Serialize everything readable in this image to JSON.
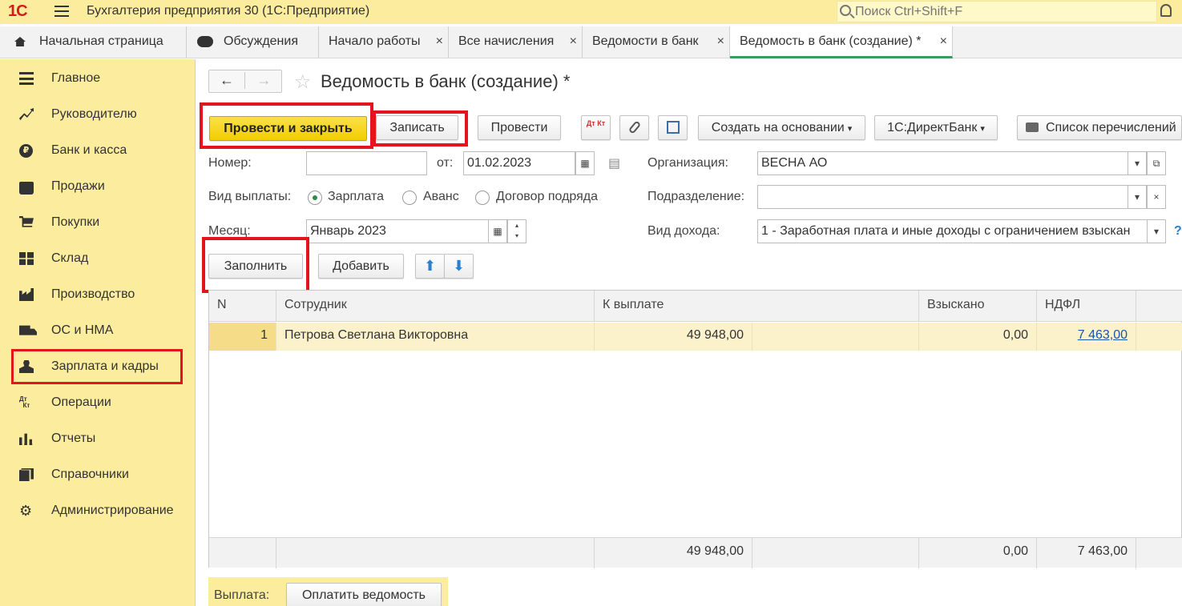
{
  "app": {
    "logo": "1С",
    "title": "Бухгалтерия предприятия 30  (1С:Предприятие)",
    "search_placeholder": "Поиск Ctrl+Shift+F"
  },
  "tabs": [
    {
      "label": "Начальная страница"
    },
    {
      "label": "Обсуждения"
    },
    {
      "label": "Начало работы"
    },
    {
      "label": "Все начисления"
    },
    {
      "label": "Ведомости в банк"
    },
    {
      "label": "Ведомость в банк (создание) *"
    }
  ],
  "close_glyph": "×",
  "sidebar": {
    "items": [
      {
        "label": "Главное",
        "icon": "menu-lines-icon"
      },
      {
        "label": "Руководителю",
        "icon": "trend-icon"
      },
      {
        "label": "Банк и касса",
        "icon": "ruble-coin-icon"
      },
      {
        "label": "Продажи",
        "icon": "bag-icon"
      },
      {
        "label": "Покупки",
        "icon": "cart-icon"
      },
      {
        "label": "Склад",
        "icon": "boxes-icon"
      },
      {
        "label": "Производство",
        "icon": "factory-icon"
      },
      {
        "label": "ОС и НМА",
        "icon": "truck-icon"
      },
      {
        "label": "Зарплата и кадры",
        "icon": "person-icon"
      },
      {
        "label": "Операции",
        "icon": "dt-kt-icon"
      },
      {
        "label": "Отчеты",
        "icon": "bar-chart-icon"
      },
      {
        "label": "Справочники",
        "icon": "books-icon"
      },
      {
        "label": "Администрирование",
        "icon": "gear-icon"
      }
    ]
  },
  "document": {
    "title": "Ведомость в банк (создание) *",
    "nav_back": "←",
    "nav_forward": "→",
    "star": "☆"
  },
  "toolbar": {
    "post_close": "Провести и закрыть",
    "save": "Записать",
    "post": "Провести",
    "dtkt": "Дт Кт",
    "create_based": "Создать на основании",
    "direct_bank": "1С:ДиректБанк",
    "print_list": "Список перечислений",
    "dropdown_glyph": "▾"
  },
  "form": {
    "number_label": "Номер:",
    "number_value": "",
    "date_label": "от:",
    "date_value": "01.02.2023",
    "org_label": "Организация:",
    "org_value": "ВЕСНА АО",
    "pay_type_label": "Вид выплаты:",
    "pay_types": [
      "Зарплата",
      "Аванс",
      "Договор подряда"
    ],
    "pay_type_selected": "Зарплата",
    "dept_label": "Подразделение:",
    "dept_value": "",
    "month_label": "Месяц:",
    "month_value": "Январь 2023",
    "income_label": "Вид дохода:",
    "income_value": "1 - Заработная плата и иные доходы с ограничением взыскан",
    "help": "?"
  },
  "table_toolbar": {
    "fill": "Заполнить",
    "add": "Добавить"
  },
  "table": {
    "columns": [
      "N",
      "Сотрудник",
      "К выплате",
      "Взыскано",
      "НДФЛ"
    ],
    "rows": [
      {
        "n": "1",
        "employee": "Петрова Светлана Викторовна",
        "to_pay": "49 948,00",
        "withheld": "0,00",
        "ndfl": "7 463,00"
      }
    ],
    "totals": {
      "to_pay": "49 948,00",
      "withheld": "0,00",
      "ndfl": "7 463,00"
    }
  },
  "footer": {
    "payment_label": "Выплата:",
    "pay_button": "Оплатить ведомость"
  },
  "colors": {
    "accent": "#fbec9e",
    "primary_button": "#f2cd00",
    "highlight": "#e3141d",
    "link": "#1a56a8"
  }
}
